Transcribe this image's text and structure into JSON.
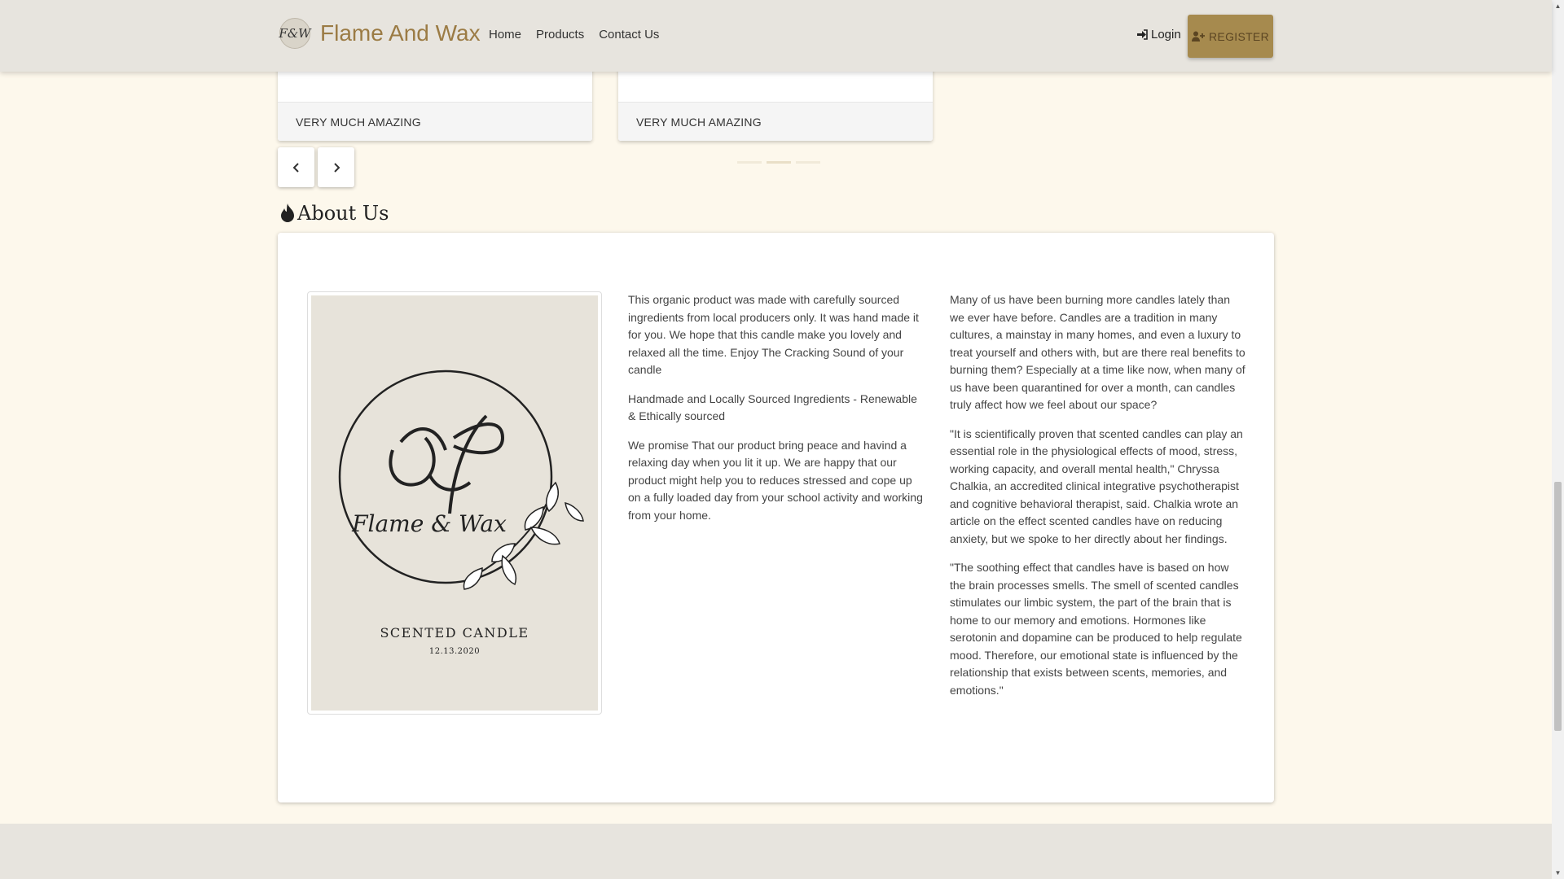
{
  "brand": {
    "logo_text": "F&W",
    "name": "Flame And Wax"
  },
  "nav": {
    "items": [
      {
        "label": "Home"
      },
      {
        "label": "Products"
      },
      {
        "label": "Contact Us"
      }
    ],
    "login_label": "Login",
    "register_label": "REGISTER"
  },
  "cards": [
    {
      "footer": "VERY MUCH AMAZING"
    },
    {
      "footer": "VERY MUCH AMAZING"
    }
  ],
  "about": {
    "title": "About Us",
    "image": {
      "logo_text": "Flame & Wax",
      "subtitle": "SCENTED CANDLE",
      "date": "12.13.2020"
    },
    "middle_paragraphs": [
      "This organic product was made with carefully sourced ingredients from local producers only. It was hand made it for you. We hope that this candle make you lovely and relaxed all the time. Enjoy The Cracking Sound of your candle",
      "Handmade and Locally Sourced Ingredients - Renewable & Ethically sourced",
      "We promise That our product bring peace and havind a relaxing day when you lit it up. We are happy that our product might help you to reduces stressed and cope up on a fully loaded day from your school activity and working from your home."
    ],
    "right_paragraphs": [
      "Many of us have been burning more candles lately than we ever have before. Candles are a tradition in many cultures, a mainstay in many homes, and even a luxury to treat yourself and others with, but are there real benefits to burning them? Especially at a time like now, when many of us have been quarantined for over a month, can candles truly affect how we feel about our space?",
      "\"It is scientifically proven that scented candles can play an essential role in the physiological effects of mood, stress, working capacity, and overall mental health,\" Chryssa Chalkia, an accredited clinical integrative psychotherapist and cognitive behavioral therapist, said. Chalkia wrote an article on the effect scented candles have on reducing anxiety, but we spoke to her directly about her findings.",
      "\"The soothing effect that candles have is based on how the brain processes smells. The smell of scented candles stimulates our limbic system, the part of the brain that is home to our memory and emotions. Hormones like serotonin and dopamine can be produced to help regulate mood. Therefore, our emotional state is influenced by the relationship that exists between scents, memories, and emotions.\""
    ]
  },
  "icons": {
    "login": "sign-in-icon",
    "register": "user-plus-icon",
    "prev": "chevron-left-icon",
    "next": "chevron-right-icon",
    "about": "fire-icon"
  },
  "colors": {
    "navbar_bg": "#e7e4de",
    "brand": "#9b7b44",
    "register_bg": "#a68a4e",
    "page_bg": "#fdf8ec"
  }
}
